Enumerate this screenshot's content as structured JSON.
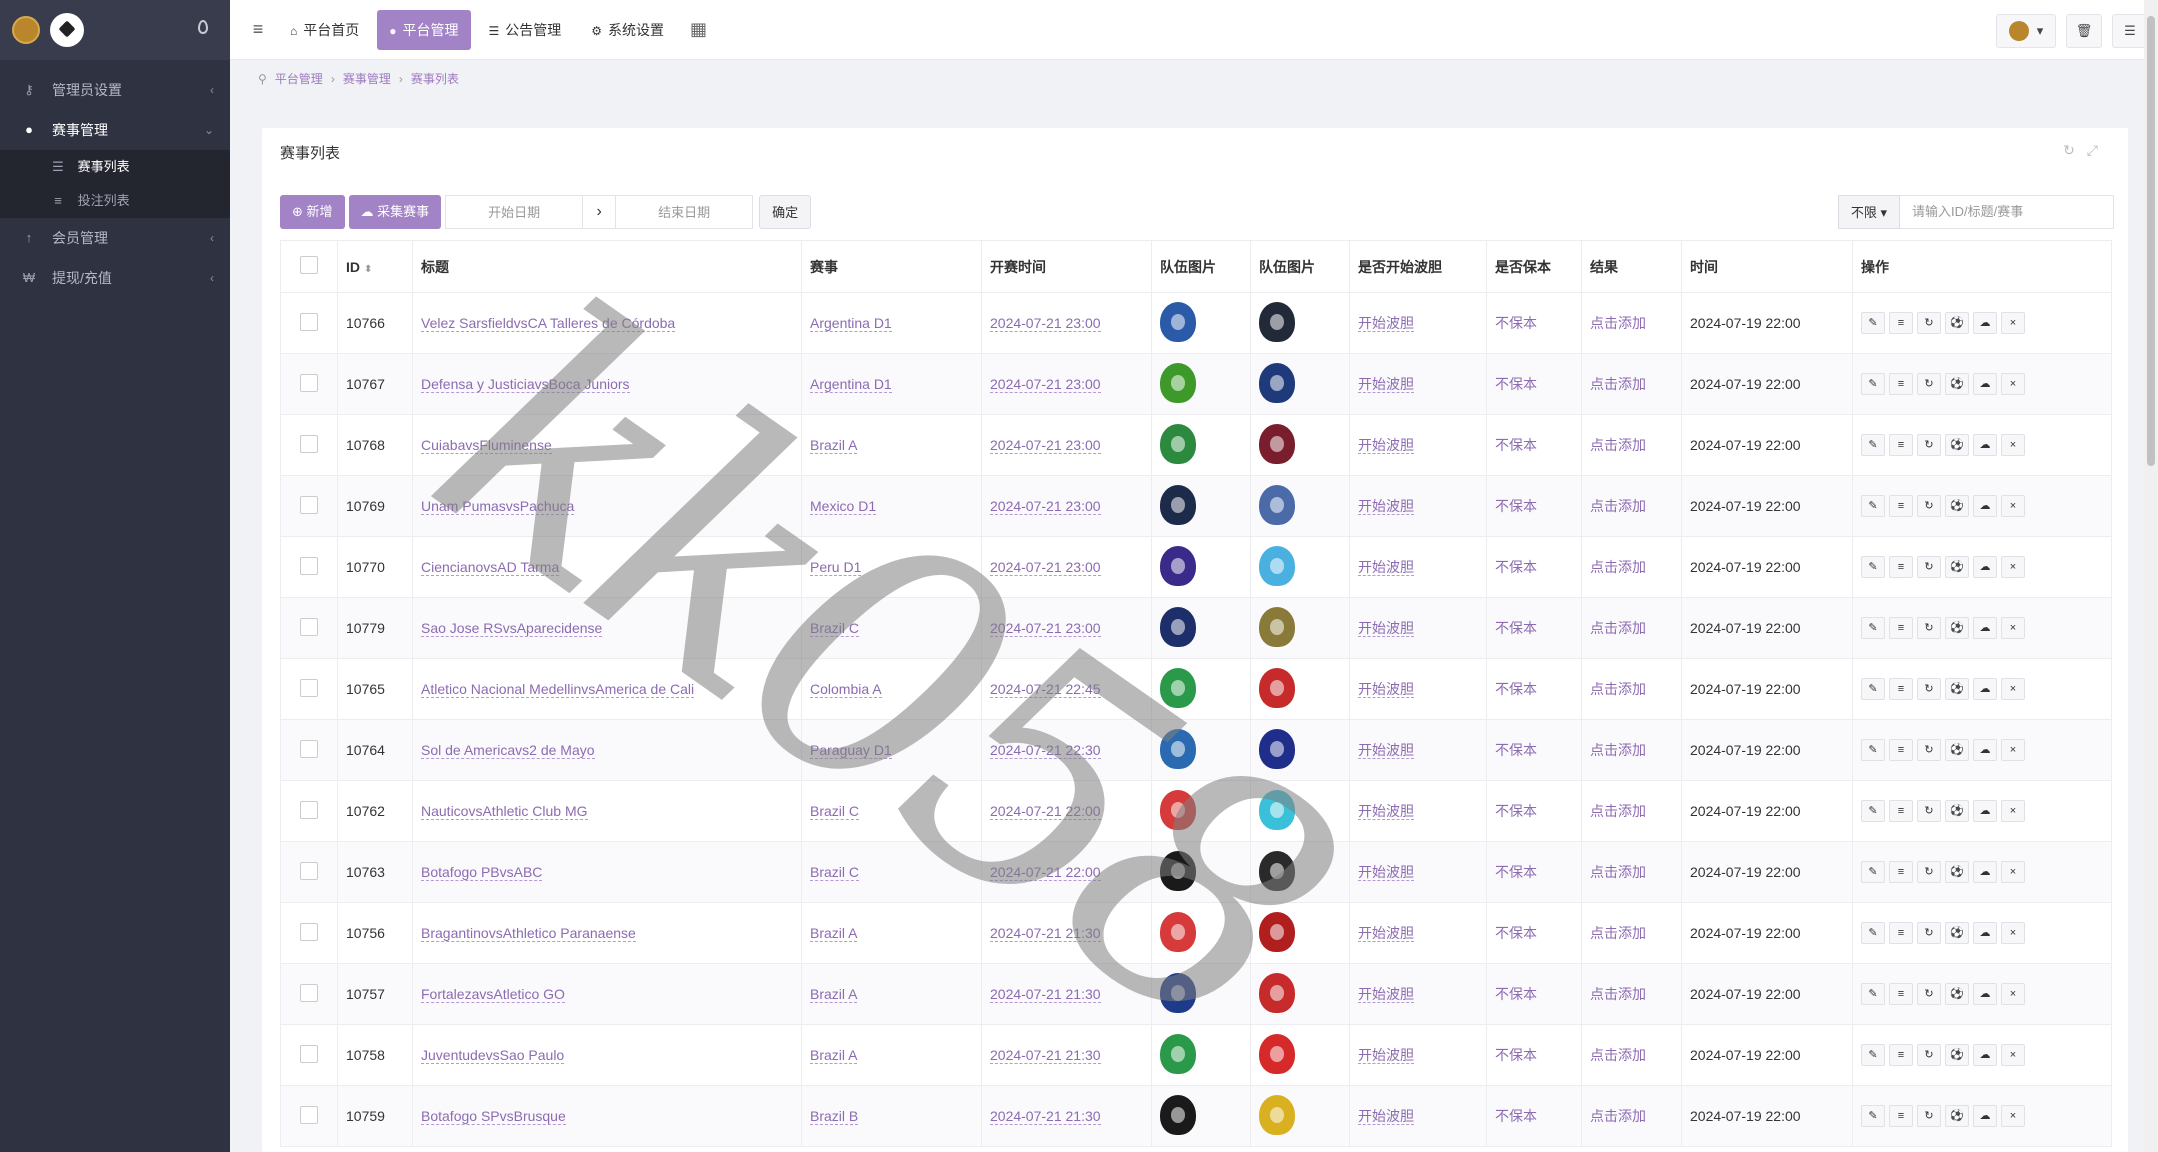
{
  "sidebar": {
    "items": [
      {
        "label": "管理员设置",
        "icon": "key-icon"
      },
      {
        "label": "赛事管理",
        "icon": "users-icon",
        "children": [
          {
            "label": "赛事列表",
            "icon": "list-icon"
          },
          {
            "label": "投注列表",
            "icon": "lines-icon"
          }
        ]
      },
      {
        "label": "会员管理",
        "icon": "arrow-up-icon"
      },
      {
        "label": "提现/充值",
        "icon": "won-icon"
      }
    ]
  },
  "topnav": {
    "tabs": [
      {
        "label": "平台首页",
        "icon": "home-icon"
      },
      {
        "label": "平台管理",
        "icon": "user-icon"
      },
      {
        "label": "公告管理",
        "icon": "list-icon"
      },
      {
        "label": "系统设置",
        "icon": "gear-icon"
      }
    ]
  },
  "breadcrumb": [
    "平台管理",
    "赛事管理",
    "赛事列表"
  ],
  "panel": {
    "title": "赛事列表",
    "toolbar": {
      "add_label": "新增",
      "collect_label": "采集赛事",
      "start_placeholder": "开始日期",
      "end_placeholder": "结束日期",
      "confirm_label": "确定",
      "filter_label": "不限",
      "search_placeholder": "请输入ID/标题/赛事"
    }
  },
  "table": {
    "headers": [
      "ID",
      "标题",
      "赛事",
      "开赛时间",
      "队伍图片",
      "队伍图片",
      "是否开始波胆",
      "是否保本",
      "结果",
      "时间",
      "操作"
    ],
    "rows": [
      {
        "id": "10766",
        "title": "Velez SarsfieldvsCA Talleres de Córdoba",
        "league": "Argentina D1",
        "start": "2024-07-21 23:00",
        "start_bet": "开始波胆",
        "guarantee": "不保本",
        "result": "点击添加",
        "time": "2024-07-19 22:00",
        "c1": "#2a5aa8",
        "c2": "#222a3a"
      },
      {
        "id": "10767",
        "title": "Defensa y JusticiavsBoca Juniors",
        "league": "Argentina D1",
        "start": "2024-07-21 23:00",
        "start_bet": "开始波胆",
        "guarantee": "不保本",
        "result": "点击添加",
        "time": "2024-07-19 22:00",
        "c1": "#3d9a2a",
        "c2": "#1e3a7a"
      },
      {
        "id": "10768",
        "title": "CuiabavsFluminense",
        "league": "Brazil A",
        "start": "2024-07-21 23:00",
        "start_bet": "开始波胆",
        "guarantee": "不保本",
        "result": "点击添加",
        "time": "2024-07-19 22:00",
        "c1": "#2b8a3e",
        "c2": "#7a1e2e"
      },
      {
        "id": "10769",
        "title": "Unam PumasvsPachuca",
        "league": "Mexico D1",
        "start": "2024-07-21 23:00",
        "start_bet": "开始波胆",
        "guarantee": "不保本",
        "result": "点击添加",
        "time": "2024-07-19 22:00",
        "c1": "#1d2b4a",
        "c2": "#4a6aa8"
      },
      {
        "id": "10770",
        "title": "CiencianovsAD Tarma",
        "league": "Peru D1",
        "start": "2024-07-21 23:00",
        "start_bet": "开始波胆",
        "guarantee": "不保本",
        "result": "点击添加",
        "time": "2024-07-19 22:00",
        "c1": "#3a2a8a",
        "c2": "#4ab0e0"
      },
      {
        "id": "10779",
        "title": "Sao Jose RSvsAparecidense",
        "league": "Brazil C",
        "start": "2024-07-21 23:00",
        "start_bet": "开始波胆",
        "guarantee": "不保本",
        "result": "点击添加",
        "time": "2024-07-19 22:00",
        "c1": "#1e2e6a",
        "c2": "#8a7a3a"
      },
      {
        "id": "10765",
        "title": "Atletico Nacional MedellinvsAmerica de Cali",
        "league": "Colombia A",
        "start": "2024-07-21 22:45",
        "start_bet": "开始波胆",
        "guarantee": "不保本",
        "result": "点击添加",
        "time": "2024-07-19 22:00",
        "c1": "#2a9a4a",
        "c2": "#c62a2a"
      },
      {
        "id": "10764",
        "title": "Sol de Americavs2 de Mayo",
        "league": "Paraguay D1",
        "start": "2024-07-21 22:30",
        "start_bet": "开始波胆",
        "guarantee": "不保本",
        "result": "点击添加",
        "time": "2024-07-19 22:00",
        "c1": "#2a6ab0",
        "c2": "#1e2e8a"
      },
      {
        "id": "10762",
        "title": "NauticovsAthletic Club MG",
        "league": "Brazil C",
        "start": "2024-07-21 22:00",
        "start_bet": "开始波胆",
        "guarantee": "不保本",
        "result": "点击添加",
        "time": "2024-07-19 22:00",
        "c1": "#d63a3a",
        "c2": "#3ac0d8"
      },
      {
        "id": "10763",
        "title": "Botafogo PBvsABC",
        "league": "Brazil C",
        "start": "2024-07-21 22:00",
        "start_bet": "开始波胆",
        "guarantee": "不保本",
        "result": "点击添加",
        "time": "2024-07-19 22:00",
        "c1": "#1a1a1a",
        "c2": "#2a2a2a"
      },
      {
        "id": "10756",
        "title": "BragantinovsAthletico Paranaense",
        "league": "Brazil A",
        "start": "2024-07-21 21:30",
        "start_bet": "开始波胆",
        "guarantee": "不保本",
        "result": "点击添加",
        "time": "2024-07-19 22:00",
        "c1": "#d63a3a",
        "c2": "#b01e1e"
      },
      {
        "id": "10757",
        "title": "FortalezavsAtletico GO",
        "league": "Brazil A",
        "start": "2024-07-21 21:30",
        "start_bet": "开始波胆",
        "guarantee": "不保本",
        "result": "点击添加",
        "time": "2024-07-19 22:00",
        "c1": "#1e3a8a",
        "c2": "#c62a2a"
      },
      {
        "id": "10758",
        "title": "JuventudevsSao Paulo",
        "league": "Brazil A",
        "start": "2024-07-21 21:30",
        "start_bet": "开始波胆",
        "guarantee": "不保本",
        "result": "点击添加",
        "time": "2024-07-19 22:00",
        "c1": "#2a9a4a",
        "c2": "#d62a2a"
      },
      {
        "id": "10759",
        "title": "Botafogo SPvsBrusque",
        "league": "Brazil B",
        "start": "2024-07-21 21:30",
        "start_bet": "开始波胆",
        "guarantee": "不保本",
        "result": "点击添加",
        "time": "2024-07-19 22:00",
        "c1": "#1a1a1a",
        "c2": "#d8b020"
      }
    ]
  },
  "watermark": "kk058",
  "accent": "#a283c6",
  "link_color": "#8c6bb1",
  "sidebar_color": "#2f3241"
}
